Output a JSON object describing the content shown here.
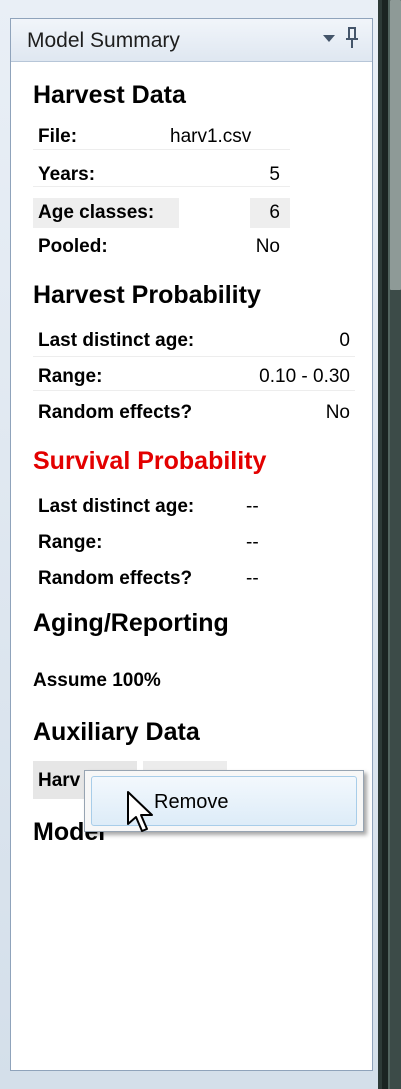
{
  "panel": {
    "title": "Model Summary"
  },
  "harvest_data": {
    "heading": "Harvest Data",
    "rows": [
      {
        "label": "File:",
        "value": "harv1.csv"
      },
      {
        "label": "Years:",
        "value": "5"
      },
      {
        "label": "Age classes:",
        "value": "6"
      },
      {
        "label": "Pooled:",
        "value": "No"
      }
    ]
  },
  "harvest_probability": {
    "heading": "Harvest Probability",
    "rows": [
      {
        "label": "Last distinct age:",
        "value": "0"
      },
      {
        "label": "Range:",
        "value": "0.10 - 0.30"
      },
      {
        "label": "Random effects?",
        "value": "No"
      }
    ]
  },
  "survival_probability": {
    "heading": "Survival Probability",
    "color": "#e30000",
    "rows": [
      {
        "label": "Last distinct age:",
        "value": "--"
      },
      {
        "label": "Range:",
        "value": "--"
      },
      {
        "label": "Random effects?",
        "value": "--"
      }
    ]
  },
  "aging_reporting": {
    "heading": "Aging/Reporting",
    "text": "Assume 100%"
  },
  "auxiliary_data": {
    "heading": "Auxiliary Data",
    "item_label": "Harv"
  },
  "model": {
    "heading": "Model"
  },
  "context_menu": {
    "items": [
      {
        "label": "Remove"
      }
    ]
  }
}
